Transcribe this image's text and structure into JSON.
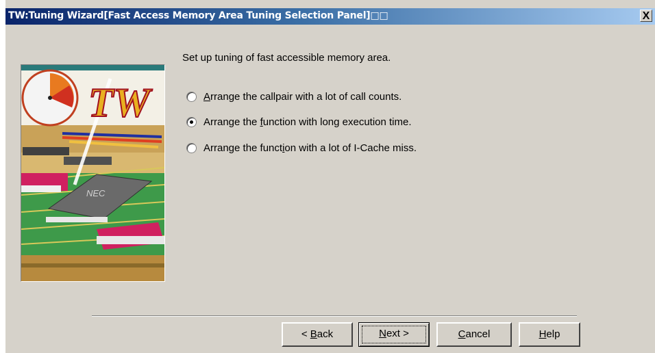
{
  "window": {
    "title": "TW:Tuning Wizard[Fast Access Memory Area Tuning Selection Panel]□□",
    "close_label": "X"
  },
  "panel": {
    "instruction": "Set up tuning of fast accessible memory area.",
    "image_chip_text": "NEC",
    "image_logo_text": "TW",
    "options": [
      {
        "pre": "",
        "mn": "A",
        "post": "rrange the callpair with a lot of call counts.",
        "selected": false
      },
      {
        "pre": "Arrange the ",
        "mn": "f",
        "post": "unction with long execution time.",
        "selected": true
      },
      {
        "pre": "Arrange the funct",
        "mn": "i",
        "post": "on with a lot of I-Cache miss.",
        "selected": false
      }
    ]
  },
  "buttons": {
    "back": {
      "pre": "< ",
      "mn": "B",
      "post": "ack"
    },
    "next": {
      "pre": "",
      "mn": "N",
      "post": "ext >"
    },
    "cancel": {
      "pre": "",
      "mn": "C",
      "post": "ancel"
    },
    "help": {
      "pre": "",
      "mn": "H",
      "post": "elp"
    }
  },
  "colors": {
    "titlebar_start": "#0a246a",
    "titlebar_end": "#a6caf0",
    "dialog_bg": "#d6d2ca"
  }
}
